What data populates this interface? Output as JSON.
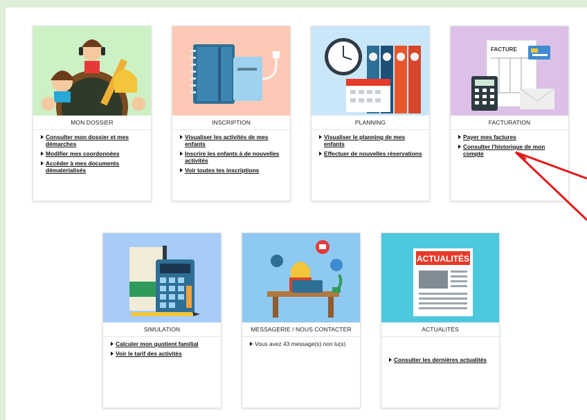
{
  "cards": [
    {
      "title": "MON DOSSIER",
      "links": [
        "Consulter mon dossier et mes démarches",
        "Modifier mes coordonnées",
        "Accéder à mes documents dématerialisés"
      ]
    },
    {
      "title": "INSCRIPTION",
      "links": [
        "Visualiser les activités de mes enfants",
        "Inscrire les enfants à de nouvelles activités",
        "Voir toutes tes inscriptions"
      ]
    },
    {
      "title": "PLANNING",
      "links": [
        "Visualiser le planning de mes enfants",
        "Effectuer de nouvelles réservations"
      ]
    },
    {
      "title": "FACTURATION",
      "links": [
        "Payer mes factures",
        "Consulter l'historique de mon compte"
      ],
      "image_text": "FACTURE"
    },
    {
      "title": "SIMULATION",
      "links": [
        "Calculer mon quotient familial",
        "Voir le tarif des activités"
      ]
    },
    {
      "title": "MESSAGERIE / NOUS CONTACTER",
      "message": "Vous avez 43 message(s) non lu(s)"
    },
    {
      "title": "ACTUALITÉS",
      "links": [
        "Consulter les dernières actualités"
      ],
      "image_text": "ACTUALITÉS"
    }
  ],
  "colors": {
    "page_bg": "#dfeed6",
    "dossier_bg": "#cdf0c4",
    "inscription_bg": "#fdc9b6",
    "planning_bg": "#c9e7f8",
    "facturation_bg": "#dcc0e8",
    "simulation_bg": "#a6ccf7",
    "messagerie_bg": "#8ec9f2",
    "actualites_bg": "#4ec8dd",
    "arrow": "#e21a1a"
  }
}
